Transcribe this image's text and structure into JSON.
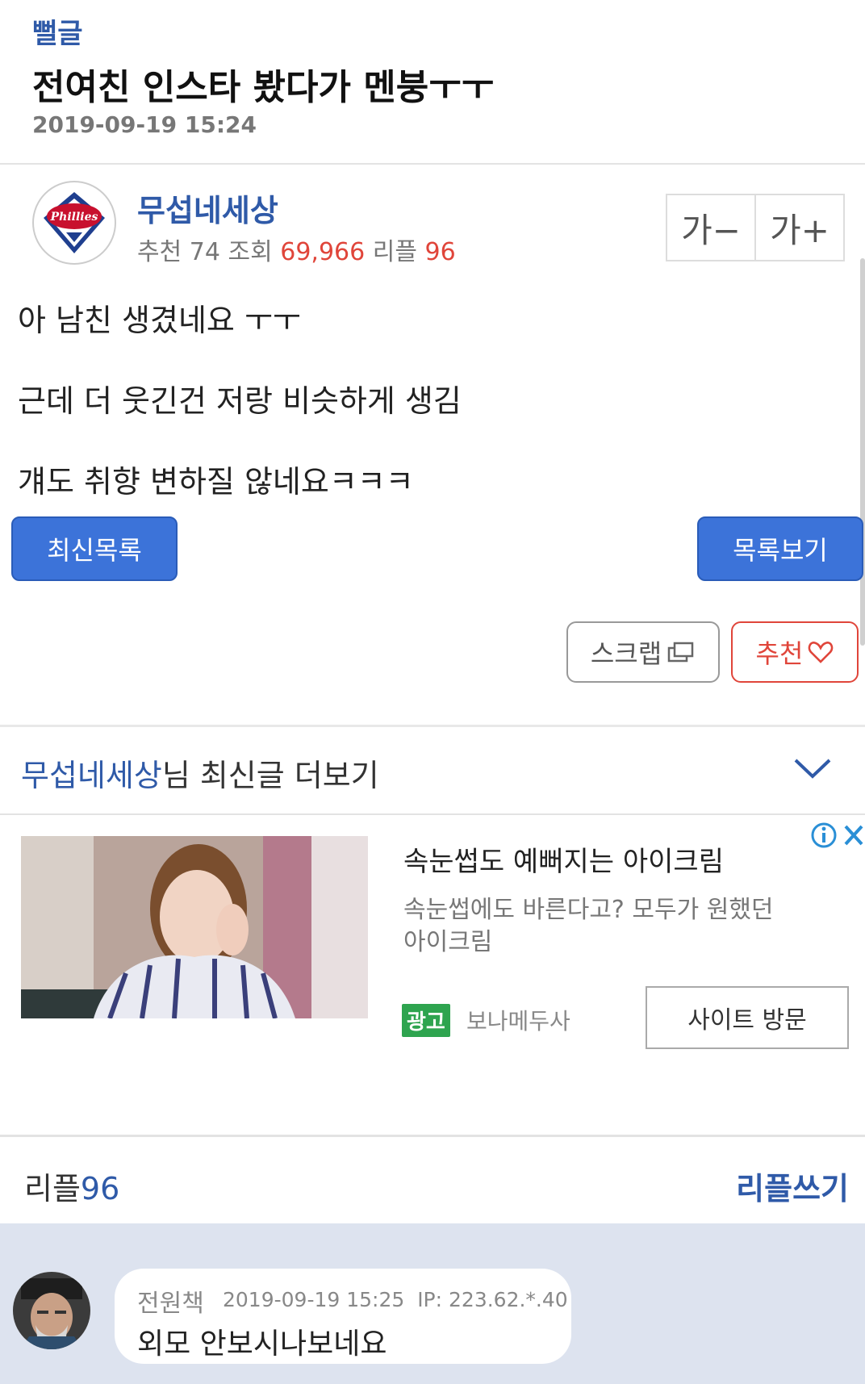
{
  "post": {
    "category": "뻘글",
    "title": "전여친 인스타 봤다가 멘붕ㅜㅜ",
    "date": "2019-09-19 15:24",
    "author": "무섭네세상",
    "avatar_logo_text": "Phillies",
    "stats": {
      "recommend_label": "추천",
      "recommend_count": "74",
      "views_label": "조회",
      "views_count": "69,966",
      "replies_label": "리플",
      "replies_count": "96"
    },
    "font_decrease": "가−",
    "font_increase": "가+",
    "body_lines": [
      "아 남친 생겼네요 ㅜㅜ",
      "근데 더 웃긴건 저랑 비슷하게 생김",
      "걔도 취향 변하질 않네요ㅋㅋㅋ"
    ]
  },
  "nav": {
    "latest_list": "최신목록",
    "view_list": "목록보기"
  },
  "actions": {
    "scrap": "스크랩",
    "recommend": "추천"
  },
  "more_posts": {
    "author": "무섭네세상",
    "suffix": "님 최신글 더보기"
  },
  "ad": {
    "title": "속눈썹도 예뻐지는 아이크림",
    "desc": "속눈썹에도 바른다고? 모두가 원했던 아이크림",
    "badge": "광고",
    "sponsor": "보나메두사",
    "visit": "사이트 방문"
  },
  "replies": {
    "label": "리플",
    "count": "96",
    "write": "리플쓰기"
  },
  "comments": [
    {
      "name": "전원책",
      "date": "2019-09-19 15:25",
      "ip": "IP: 223.62.*.40",
      "text": "외모 안보시나보네요"
    }
  ],
  "colors": {
    "link_blue": "#2f5aa8",
    "button_blue": "#3c73d9",
    "accent_red": "#e0453a",
    "ad_green": "#2ea44f",
    "comment_bg": "#dde3ef"
  }
}
